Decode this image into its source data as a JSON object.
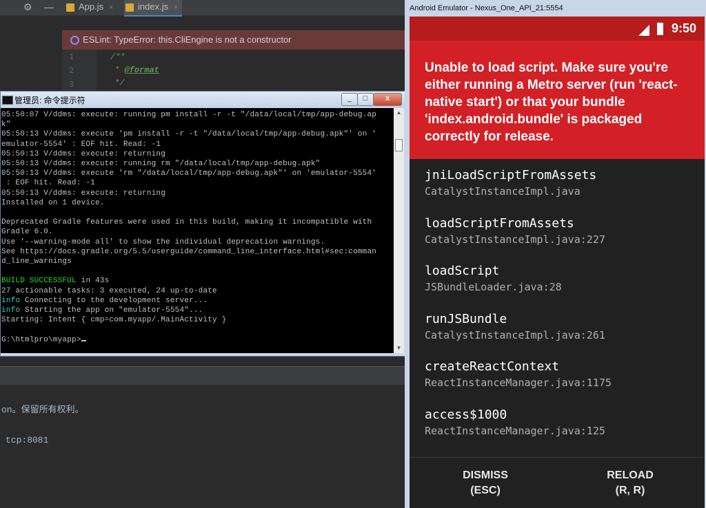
{
  "ide": {
    "tabs": [
      {
        "label": "App.js",
        "close": "×"
      },
      {
        "label": "index.js",
        "close": "×"
      }
    ],
    "eslint_error": "ESLint: TypeError: this.CliEngine is not a constructor",
    "line_numbers": [
      "1",
      "2",
      "3"
    ],
    "code_lines": [
      "/**",
      "* ",
      "*/"
    ],
    "code_tag": "@format",
    "terminal_lines": [
      "on。保留所有权利。",
      "tcp:8081"
    ]
  },
  "cmd": {
    "title": "管理员: 命令提示符",
    "buttons": {
      "minimize": "_",
      "maximize": "□",
      "close": "x"
    },
    "lines": [
      {
        "text": "05:50:07 V/ddms: execute: running pm install -r -t \"/data/local/tmp/app-debug.ap",
        "style": ""
      },
      {
        "text": "k\"",
        "style": ""
      },
      {
        "text": "05:50:13 V/ddms: execute 'pm install -r -t \"/data/local/tmp/app-debug.apk\"' on '",
        "style": ""
      },
      {
        "text": "emulator-5554' : EOF hit. Read: -1",
        "style": ""
      },
      {
        "text": "05:50:13 V/ddms: execute: returning",
        "style": ""
      },
      {
        "text": "05:50:13 V/ddms: execute: running rm \"/data/local/tmp/app-debug.apk\"",
        "style": ""
      },
      {
        "text": "05:50:13 V/ddms: execute 'rm \"/data/local/tmp/app-debug.apk\"' on 'emulator-5554'",
        "style": ""
      },
      {
        "text": " : EOF hit. Read: -1",
        "style": ""
      },
      {
        "text": "05:50:13 V/ddms: execute: returning",
        "style": ""
      },
      {
        "text": "Installed on 1 device.",
        "style": ""
      },
      {
        "text": "",
        "style": ""
      },
      {
        "text": "Deprecated Gradle features were used in this build, making it incompatible with",
        "style": ""
      },
      {
        "text": "Gradle 6.0.",
        "style": ""
      },
      {
        "text": "Use '--warning-mode all' to show the individual deprecation warnings.",
        "style": ""
      },
      {
        "text": "See https://docs.gradle.org/5.5/userguide/command_line_interface.html#sec:comman",
        "style": ""
      },
      {
        "text": "d_line_warnings",
        "style": ""
      },
      {
        "text": "",
        "style": ""
      },
      {
        "text": "in 43s",
        "prefix": "BUILD SUCCESSFUL",
        "style": "green"
      },
      {
        "text": "27 actionable tasks: 3 executed, 24 up-to-date",
        "style": ""
      },
      {
        "text": "Connecting to the development server...",
        "prefix": "info",
        "style": "cyan"
      },
      {
        "text": "Starting the app on \"emulator-5554\"...",
        "prefix": "info",
        "style": "cyan"
      },
      {
        "text": "Starting: Intent { cmp=com.myapp/.MainActivity }",
        "style": ""
      },
      {
        "text": "",
        "style": ""
      },
      {
        "text": "G:\\htmlpro\\myapp>",
        "style": "prompt"
      }
    ]
  },
  "emulator": {
    "window_title": "Android Emulator - Nexus_One_API_21:5554",
    "clock": "9:50",
    "error_message": "Unable to load script. Make sure you're either running a Metro server (run 'react-native start') or that your bundle 'index.android.bundle' is packaged correctly for release.",
    "stack": [
      {
        "method": "jniLoadScriptFromAssets",
        "location": "CatalystInstanceImpl.java"
      },
      {
        "method": "loadScriptFromAssets",
        "location": "CatalystInstanceImpl.java:227"
      },
      {
        "method": "loadScript",
        "location": "JSBundleLoader.java:28"
      },
      {
        "method": "runJSBundle",
        "location": "CatalystInstanceImpl.java:261"
      },
      {
        "method": "createReactContext",
        "location": "ReactInstanceManager.java:1175"
      },
      {
        "method": "access$1000",
        "location": "ReactInstanceManager.java:125"
      }
    ],
    "dismiss": {
      "label": "DISMISS",
      "shortcut": "(ESC)"
    },
    "reload": {
      "label": "RELOAD",
      "shortcut": "(R, R)"
    },
    "colors": {
      "error_red": "#d32027",
      "status_red": "#b71c1c",
      "background": "#212121"
    }
  }
}
